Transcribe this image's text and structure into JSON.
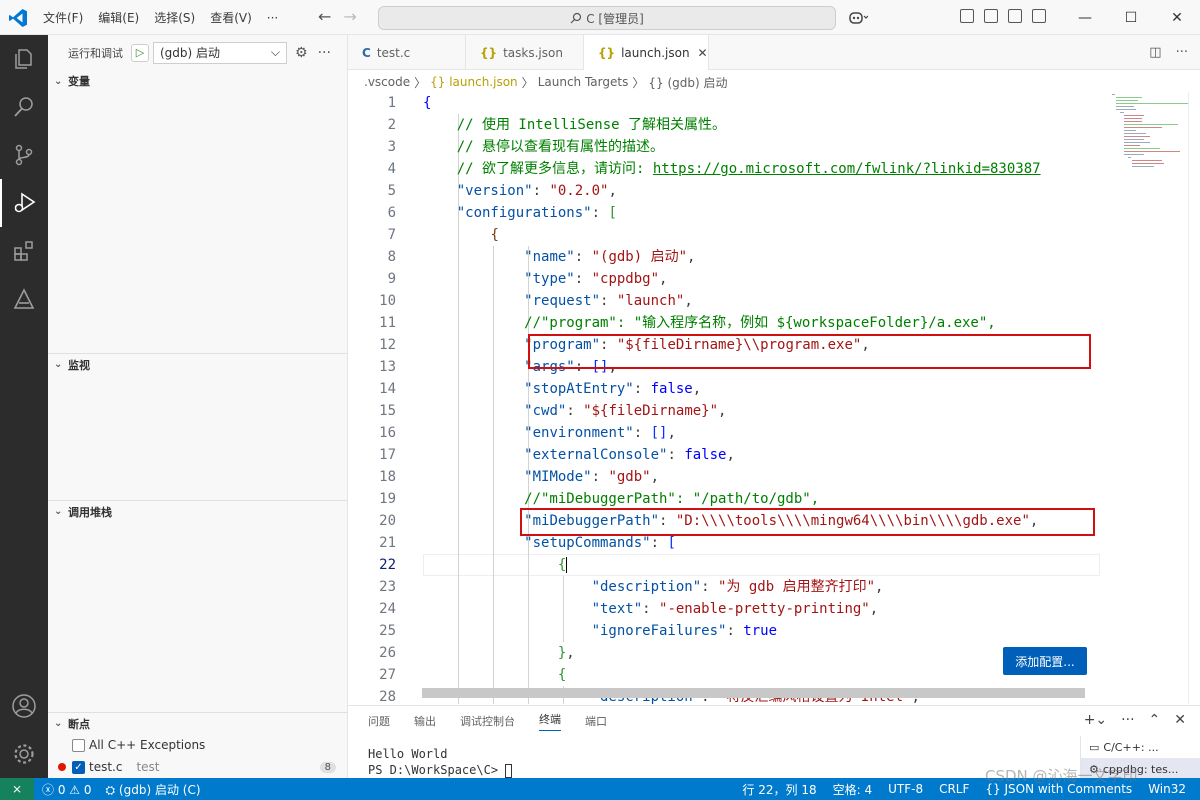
{
  "menu": [
    "文件(F)",
    "编辑(E)",
    "选择(S)",
    "查看(V)",
    "···"
  ],
  "search": {
    "text": "C [管理员]"
  },
  "sidebar": {
    "title": "运行和调试",
    "config": "(gdb) 启动",
    "sections": {
      "variables": "变量",
      "watch": "监视",
      "callstack": "调用堆栈",
      "breakpoints": "断点"
    },
    "breakpoints": [
      {
        "label": "All C++ Exceptions",
        "checked": false
      },
      {
        "label": "test.c",
        "path": "test",
        "count": "8",
        "checked": true
      }
    ]
  },
  "tabs": [
    {
      "icon": "C",
      "label": "test.c"
    },
    {
      "icon": "{}",
      "label": "tasks.json"
    },
    {
      "icon": "{}",
      "label": "launch.json",
      "active": true
    }
  ],
  "breadcrumb": [
    ".vscode",
    "〉",
    "{} launch.json",
    "〉",
    "Launch Targets",
    "〉",
    "{} (gdb) 启动"
  ],
  "code": {
    "line_numbers": [
      "1",
      "2",
      "3",
      "4",
      "5",
      "6",
      "7",
      "8",
      "9",
      "10",
      "11",
      "12",
      "13",
      "14",
      "15",
      "16",
      "17",
      "18",
      "19",
      "20",
      "21",
      "22",
      "23",
      "24",
      "25",
      "26",
      "27",
      "28"
    ],
    "current_line": "22"
  },
  "add_config_button": "添加配置...",
  "panel": {
    "tabs": [
      "问题",
      "输出",
      "调试控制台",
      "终端",
      "端口"
    ],
    "active_tab": "终端",
    "terminal_lines": [
      "Hello World",
      "PS D:\\WorkSpace\\C> "
    ],
    "terminal_list": [
      "C/C++: ...",
      "cppdbg: tes..."
    ]
  },
  "status": {
    "errors": "0",
    "warnings": "0",
    "debug": "(gdb) 启动 (C)",
    "position": "行 22，列 18",
    "spaces": "空格: 4",
    "encoding": "UTF-8",
    "eol": "CRLF",
    "language": "{} JSON with Comments",
    "platform": "Win32"
  },
  "watermark": "CSDN @沁海一文字印"
}
